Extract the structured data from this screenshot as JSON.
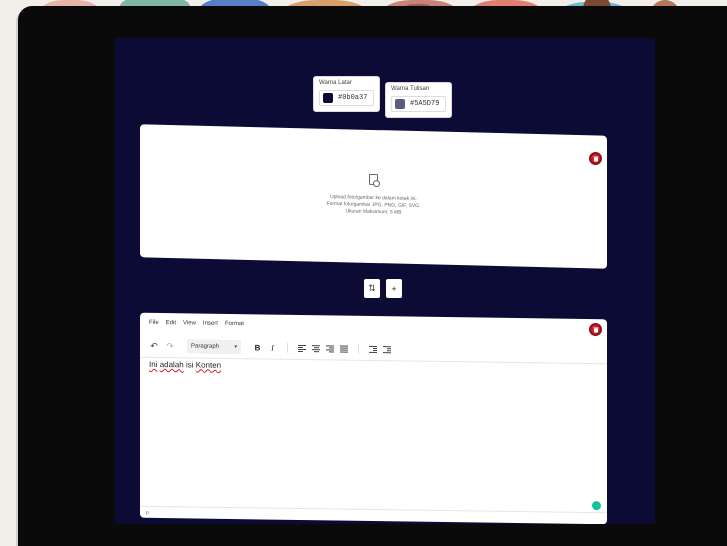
{
  "colors": {
    "screen_bg": "#0B0B36",
    "delete": "#D01F2B",
    "grammarly": "#15C39A"
  },
  "theme": {
    "bg_label": "Warna Latar",
    "bg_value": "#0b0a37",
    "bg_swatch": "#0B0A37",
    "text_label": "Warna Tulisan",
    "text_value": "#5A5D79",
    "text_swatch": "#5A5D79"
  },
  "upload": {
    "icon": "image-upload-icon",
    "line1": "Upload foto/gambar ke dalam kotak ini.",
    "line2": "Format foto/gambar JPG, PNG, GIF, SVG.",
    "line3": "Ukuran Maksimum: 5 MB"
  },
  "actions": {
    "swap_label": "⇅",
    "add_label": "+"
  },
  "editor": {
    "menu": [
      "File",
      "Edit",
      "View",
      "Insert",
      "Format"
    ],
    "format_select": "Paragraph",
    "bold_label": "B",
    "italic_label": "I",
    "content_words": [
      "Ini",
      "adalah",
      "isi",
      "Konten"
    ],
    "statusbar_text": "p"
  }
}
